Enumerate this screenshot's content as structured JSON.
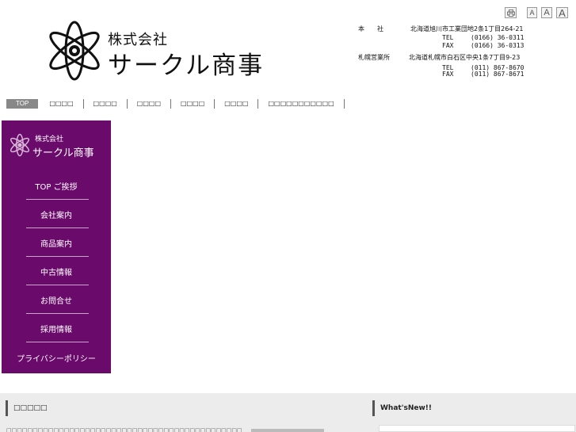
{
  "header": {
    "company_prefix": "株式会社",
    "company_name": "サークル商事",
    "font_controls": {
      "small": "A",
      "medium": "A",
      "large": "A"
    },
    "offices": [
      {
        "name": "本　　社",
        "address": "北海道旭川市工業団地2条1丁目264-21",
        "tel_label": "TEL",
        "tel": "(0166) 36-0311",
        "fax_label": "FAX",
        "fax": "(0166) 36-0313"
      },
      {
        "name": "札幌営業所",
        "address": "北海道札幌市白石区中央1条7丁目9-23",
        "tel_label": "TEL",
        "tel": "(011) 867-8670",
        "fax_label": "FAX",
        "fax": "(011) 867-8671"
      }
    ]
  },
  "topnav": {
    "items": [
      "TOP",
      "□□□□",
      "□□□□",
      "□□□□",
      "□□□□",
      "□□□□",
      "□□□□□□□□□□□"
    ]
  },
  "sidebar": {
    "logo_small": "株式会社",
    "logo_big": "サークル商事",
    "menu": [
      "TOP ご挨拶",
      "会社案内",
      "商品案内",
      "中古情報",
      "お問合せ",
      "採用情報",
      "プライバシーポリシー"
    ]
  },
  "sections": {
    "left_title": "□□□□□",
    "left_text": "□□□□□□□□□□□□□□□□□□□□□□□□□□□□□□□□□□□□□□□□□□□□□□□□□□",
    "right_title": "What'sNew!!"
  },
  "colors": {
    "sidebar_bg": "#6a0a6b",
    "band_bg": "#ececec"
  }
}
